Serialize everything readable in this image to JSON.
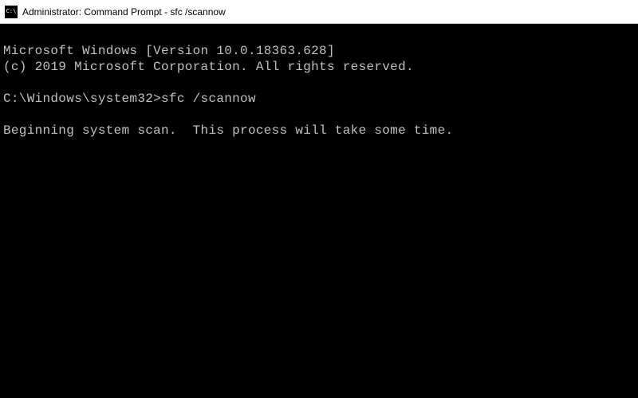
{
  "titlebar": {
    "icon_label": "C:\\",
    "title": "Administrator: Command Prompt - sfc  /scannow"
  },
  "terminal": {
    "line1": "Microsoft Windows [Version 10.0.18363.628]",
    "line2": "(c) 2019 Microsoft Corporation. All rights reserved.",
    "prompt": "C:\\Windows\\system32>",
    "command": "sfc /scannow",
    "status": "Beginning system scan.  This process will take some time."
  }
}
